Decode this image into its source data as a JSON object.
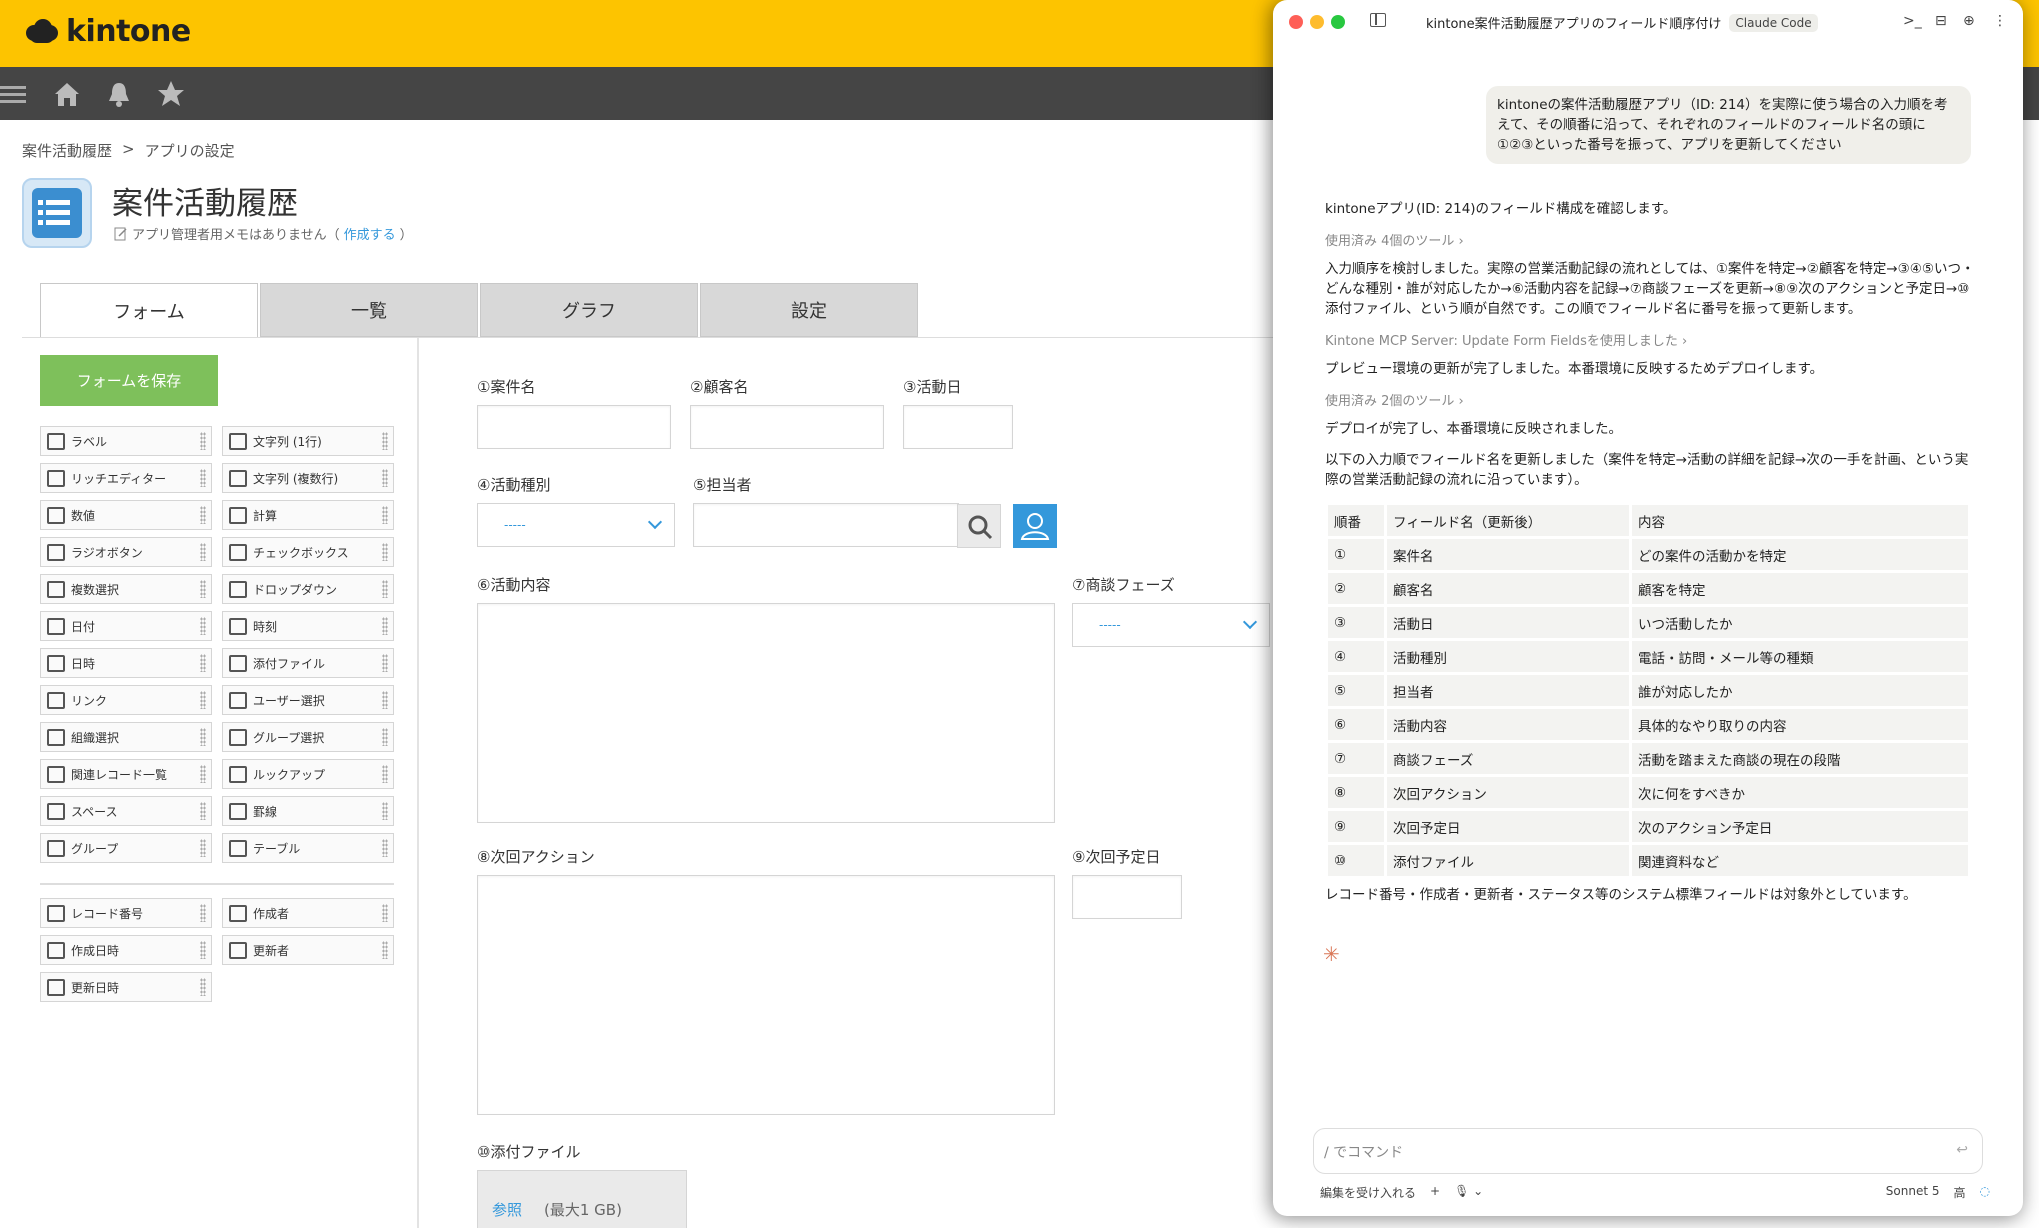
{
  "kintone": {
    "logo": "kintone",
    "breadcrumb": [
      "案件活動履歴",
      ">",
      "アプリの設定"
    ],
    "app_title": "案件活動履歴",
    "memo_text": "アプリ管理者用メモはありません（",
    "memo_link": "作成する",
    "memo_end": "）",
    "tabs": [
      "フォーム",
      "一覧",
      "グラフ",
      "設定"
    ],
    "save_label": "フォームを保存",
    "parts": [
      {
        "label": "ラベル",
        "icon": "tag-icon"
      },
      {
        "label": "文字列 (1行)",
        "icon": "abc-icon"
      },
      {
        "label": "リッチエディター",
        "icon": "rich-text-icon"
      },
      {
        "label": "文字列 (複数行)",
        "icon": "multiline-icon"
      },
      {
        "label": "数値",
        "icon": "number-icon"
      },
      {
        "label": "計算",
        "icon": "calculator-icon"
      },
      {
        "label": "ラジオボタン",
        "icon": "radio-icon"
      },
      {
        "label": "チェックボックス",
        "icon": "checkbox-icon"
      },
      {
        "label": "複数選択",
        "icon": "multiselect-icon"
      },
      {
        "label": "ドロップダウン",
        "icon": "dropdown-icon"
      },
      {
        "label": "日付",
        "icon": "calendar-icon"
      },
      {
        "label": "時刻",
        "icon": "clock-icon"
      },
      {
        "label": "日時",
        "icon": "datetime-icon"
      },
      {
        "label": "添付ファイル",
        "icon": "paperclip-icon"
      },
      {
        "label": "リンク",
        "icon": "globe-icon"
      },
      {
        "label": "ユーザー選択",
        "icon": "user-icon"
      },
      {
        "label": "組織選択",
        "icon": "org-icon"
      },
      {
        "label": "グループ選択",
        "icon": "group-icon"
      },
      {
        "label": "関連レコード一覧",
        "icon": "related-records-icon"
      },
      {
        "label": "ルックアップ",
        "icon": "lookup-icon"
      },
      {
        "label": "スペース",
        "icon": "space-icon"
      },
      {
        "label": "罫線",
        "icon": "line-icon"
      },
      {
        "label": "グループ",
        "icon": "folder-icon"
      },
      {
        "label": "テーブル",
        "icon": "table-icon"
      }
    ],
    "system_parts": [
      {
        "label": "レコード番号",
        "icon": "number-icon"
      },
      {
        "label": "作成者",
        "icon": "user-icon"
      },
      {
        "label": "作成日時",
        "icon": "calendar-icon"
      },
      {
        "label": "更新者",
        "icon": "user-icon"
      },
      {
        "label": "更新日時",
        "icon": "calendar-icon"
      }
    ],
    "fields": {
      "f1": "①案件名",
      "f2": "②顧客名",
      "f3": "③活動日",
      "f4": "④活動種別",
      "f5": "⑤担当者",
      "f6": "⑥活動内容",
      "f7": "⑦商談フェーズ",
      "f8": "⑧次回アクション",
      "f9": "⑨次回予定日",
      "f10": "⑩添付ファイル"
    },
    "dropdown_placeholder": "-----",
    "attach_browse": "参照",
    "attach_max": "(最大1 GB)"
  },
  "claude": {
    "window_title": "kintone案件活動履歴アプリのフィールド順序付け",
    "badge": "Claude Code",
    "user_message": "kintoneの案件活動履歴アプリ（ID: 214）を実際に使う場合の入力順を考えて、その順番に沿って、それぞれのフィールドのフィールド名の頭に①②③といった番号を振って、アプリを更新してください",
    "m1": "kintoneアプリ(ID: 214)のフィールド構成を確認します。",
    "tool1": "使用済み 4個のツール",
    "m2": "入力順序を検討しました。実際の営業活動記録の流れとしては、①案件を特定→②顧客を特定→③④⑤いつ・どんな種別・誰が対応したか→⑥活動内容を記録→⑦商談フェーズを更新→⑧⑨次のアクションと予定日→⑩添付ファイル、という順が自然です。この順でフィールド名に番号を振って更新します。",
    "tool2": "Kintone MCP Server: Update Form Fieldsを使用しました",
    "m3": "プレビュー環境の更新が完了しました。本番環境に反映するためデプロイします。",
    "tool3": "使用済み 2個のツール",
    "m4": "デプロイが完了し、本番環境に反映されました。",
    "m5": "以下の入力順でフィールド名を更新しました（案件を特定→活動の詳細を記録→次の一手を計画、という実際の営業活動記録の流れに沿っています）。",
    "table_headers": [
      "順番",
      "フィールド名（更新後）",
      "内容"
    ],
    "table_rows": [
      [
        "①",
        "案件名",
        "どの案件の活動かを特定"
      ],
      [
        "②",
        "顧客名",
        "顧客を特定"
      ],
      [
        "③",
        "活動日",
        "いつ活動したか"
      ],
      [
        "④",
        "活動種別",
        "電話・訪問・メール等の種類"
      ],
      [
        "⑤",
        "担当者",
        "誰が対応したか"
      ],
      [
        "⑥",
        "活動内容",
        "具体的なやり取りの内容"
      ],
      [
        "⑦",
        "商談フェーズ",
        "活動を踏まえた商談の現在の段階"
      ],
      [
        "⑧",
        "次回アクション",
        "次に何をすべきか"
      ],
      [
        "⑨",
        "次回予定日",
        "次のアクション予定日"
      ],
      [
        "⑩",
        "添付ファイル",
        "関連資料など"
      ]
    ],
    "m6": "レコード番号・作成者・更新者・ステータス等のシステム標準フィールドは対象外としています。",
    "composer_placeholder": "/ でコマンド",
    "footer_accept": "編集を受け入れる",
    "footer_plus": "+",
    "model": "Sonnet 5",
    "effort": "高"
  },
  "colors": {
    "kintone_yellow": "#fdc400",
    "kintone_nav": "#454545",
    "save_green": "#7ec05b",
    "link_blue": "#3498db",
    "claude_accent": "#d97757"
  }
}
